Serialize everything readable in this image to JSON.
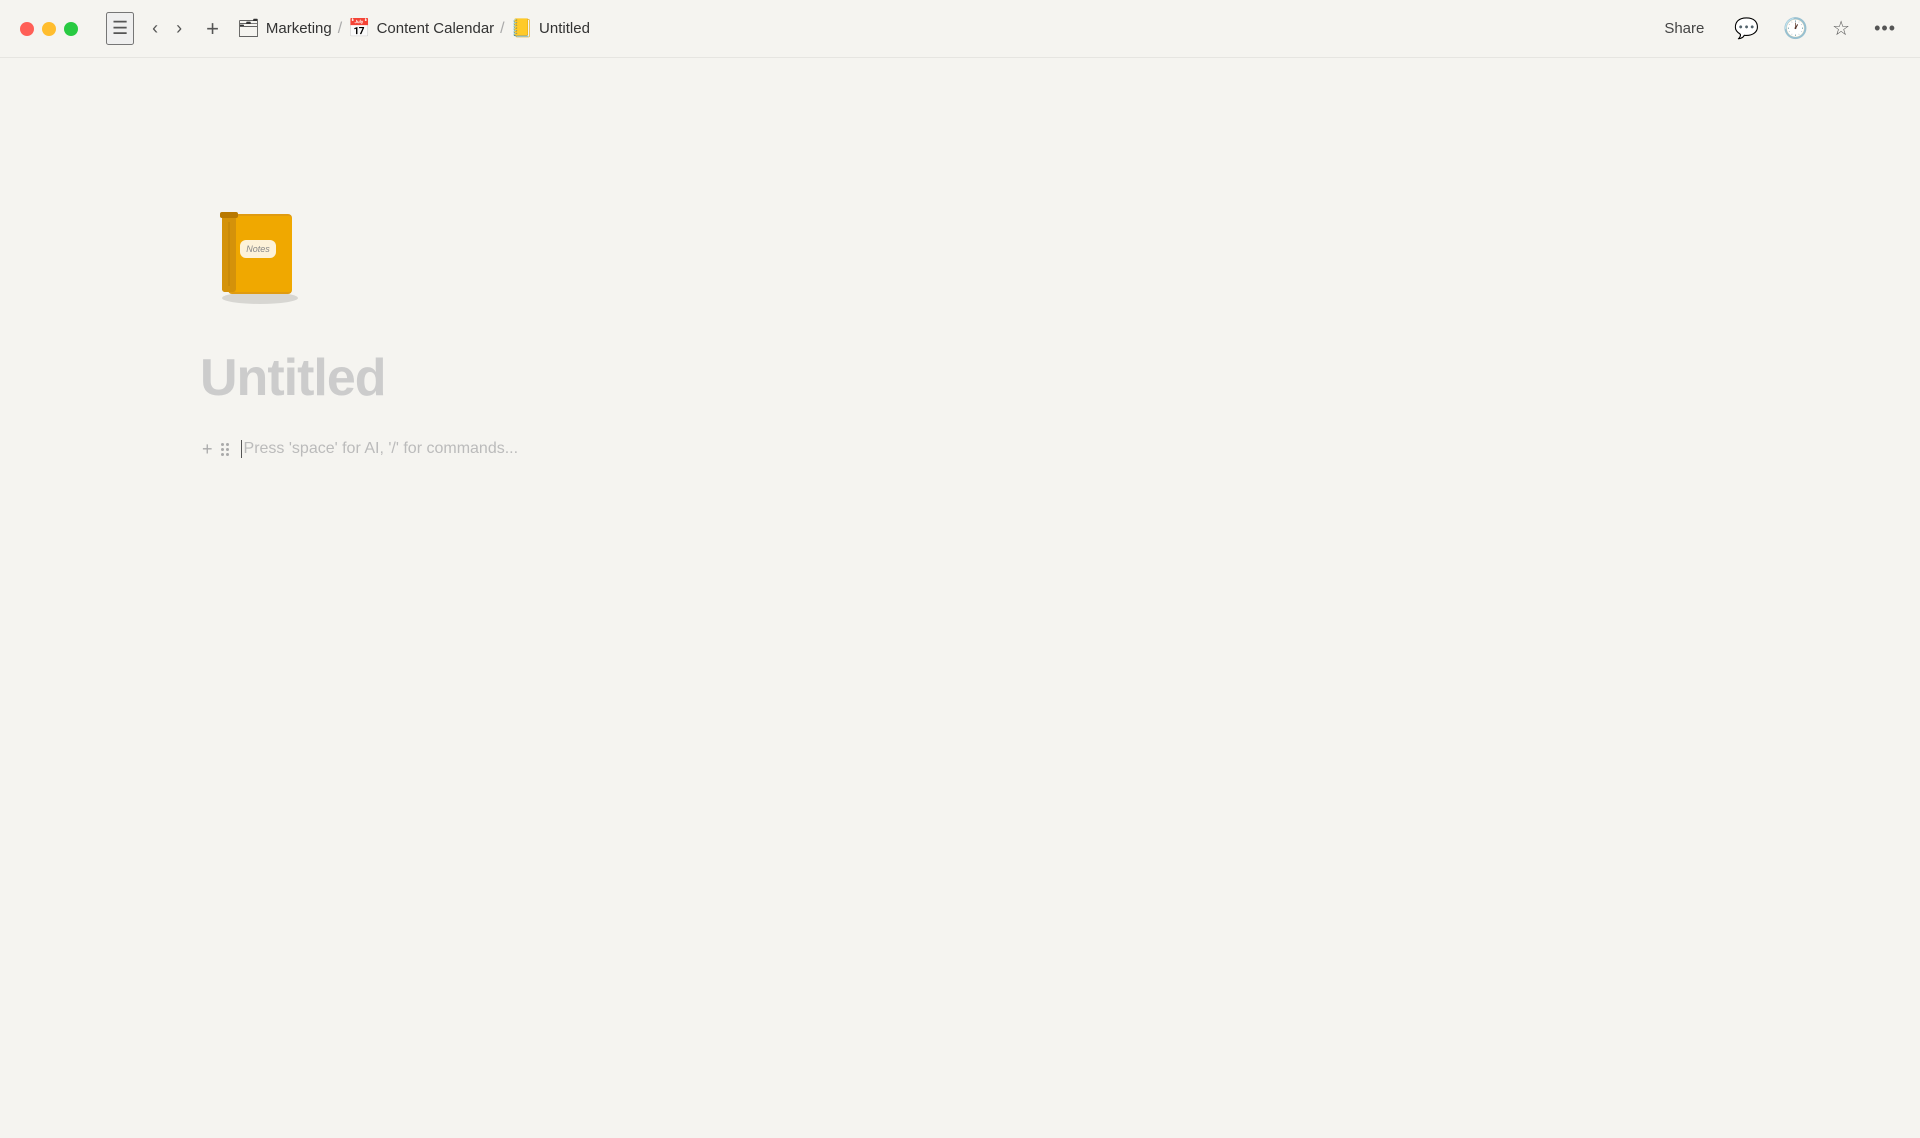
{
  "titlebar": {
    "traffic_lights": {
      "close_label": "close",
      "minimize_label": "minimize",
      "maximize_label": "maximize"
    },
    "sidebar_toggle_label": "☰",
    "nav_back_label": "‹",
    "nav_forward_label": "›",
    "add_label": "+",
    "breadcrumb": {
      "items": [
        {
          "icon": "🗂",
          "label": "Marketing"
        },
        {
          "icon": "📅",
          "label": "Content Calendar"
        },
        {
          "icon": "📒",
          "label": "Untitled"
        }
      ],
      "separator": "/"
    },
    "share_label": "Share",
    "icons": {
      "comment": "💬",
      "history": "🕐",
      "star": "☆",
      "more": "···"
    }
  },
  "page": {
    "title": "Untitled",
    "placeholder": "Press 'space' for AI, '/' for commands..."
  },
  "notebook_icon": {
    "alt": "Notebook emoji icon"
  },
  "block": {
    "add_label": "+",
    "drag_label": "drag"
  }
}
